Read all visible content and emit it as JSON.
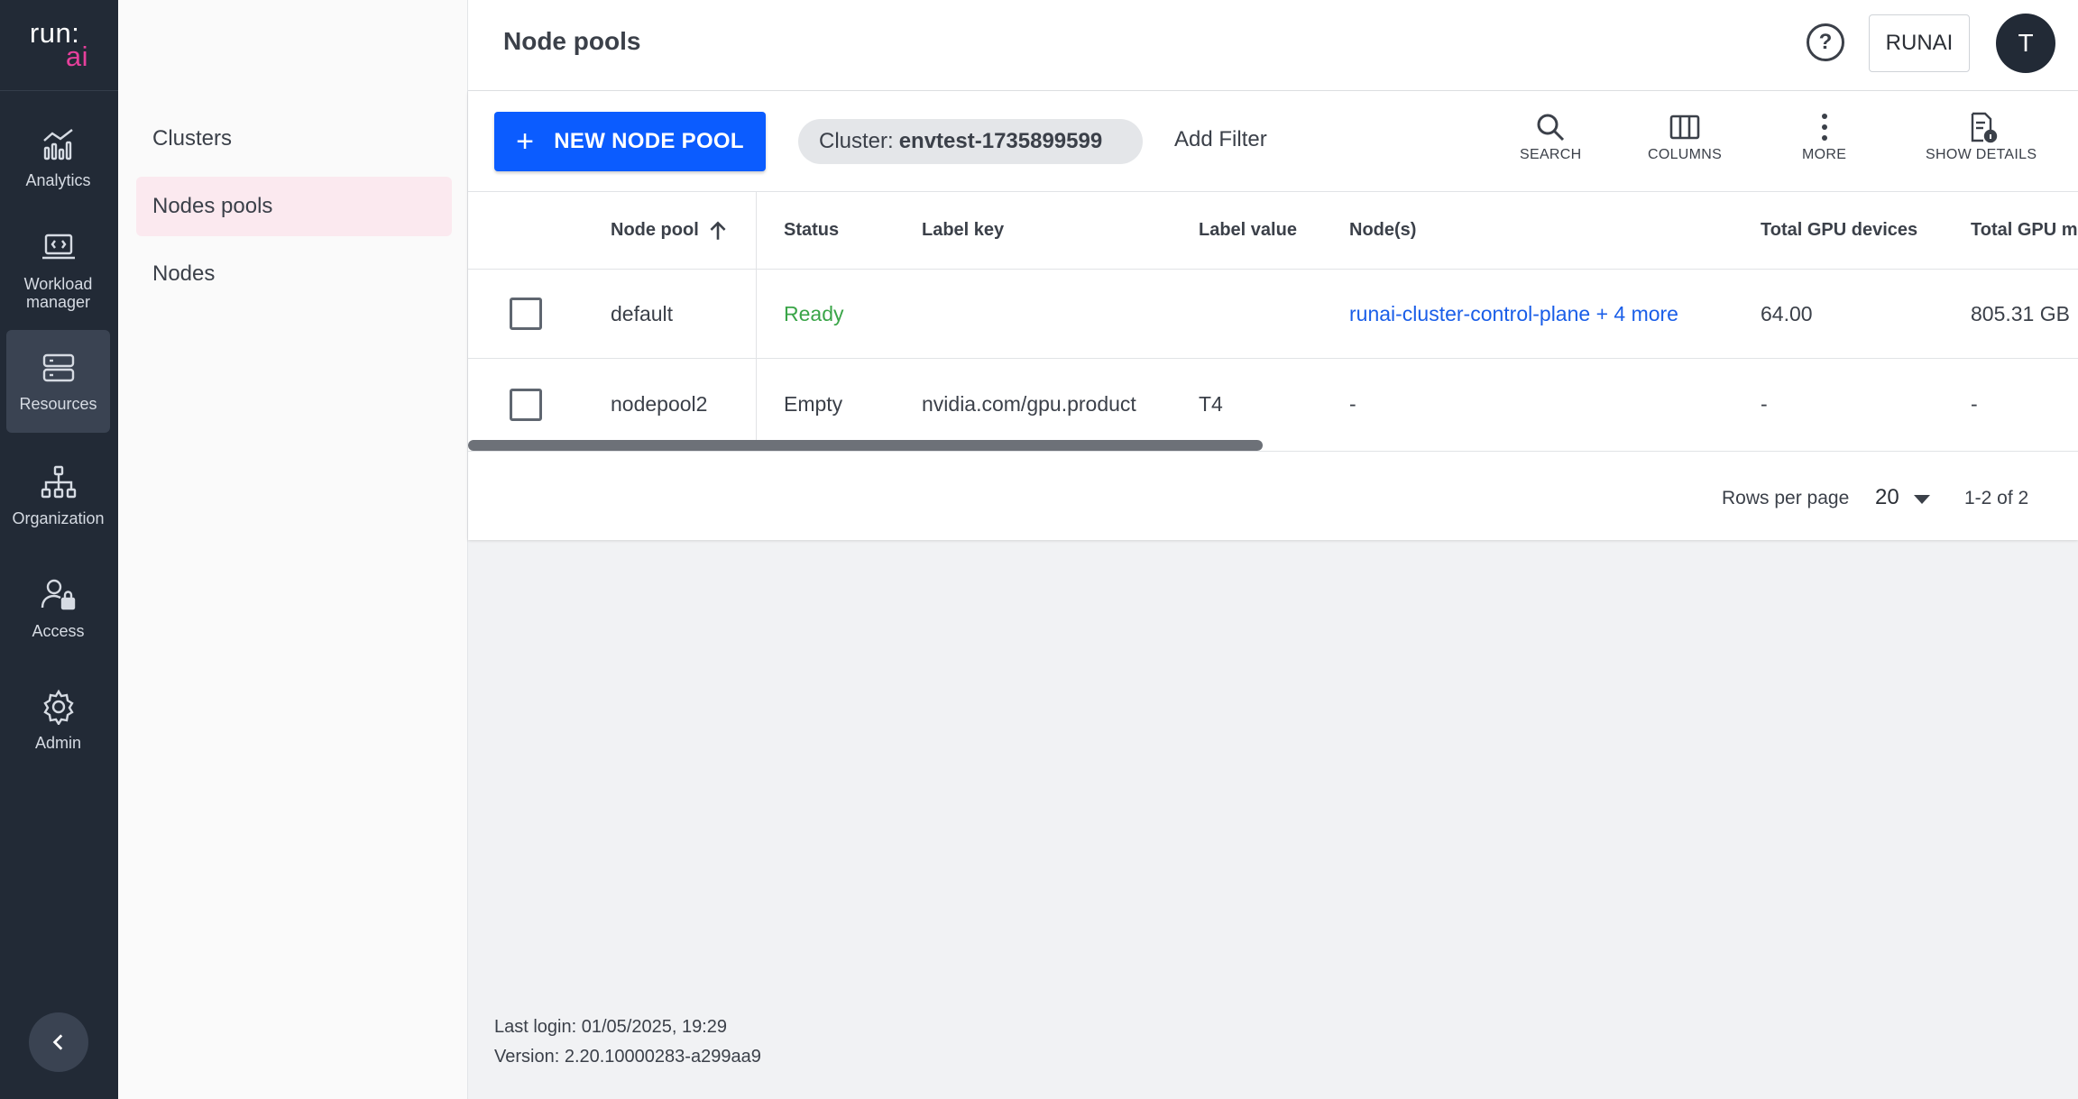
{
  "brand": {
    "logo_top": "run:",
    "logo_bottom": "ai"
  },
  "rail": {
    "items": [
      {
        "label": "Analytics",
        "icon": "analytics-icon"
      },
      {
        "label": "Workload manager",
        "icon": "laptop-code-icon"
      },
      {
        "label": "Resources",
        "icon": "server-icon",
        "active": true
      },
      {
        "label": "Organization",
        "icon": "org-chart-icon"
      },
      {
        "label": "Access",
        "icon": "user-lock-icon"
      },
      {
        "label": "Admin",
        "icon": "gear-icon"
      }
    ],
    "collapse_icon": "chevron-left-icon"
  },
  "submenu": {
    "items": [
      {
        "label": "Clusters"
      },
      {
        "label": "Nodes pools",
        "active": true
      },
      {
        "label": "Nodes"
      }
    ]
  },
  "header": {
    "title": "Node pools",
    "help": "?",
    "tenant": "RUNAI",
    "avatar": "T"
  },
  "toolbar": {
    "new_button": "NEW NODE POOL",
    "plus": "+",
    "filter_chip_key": "Cluster:",
    "filter_chip_value": "envtest-1735899599",
    "add_filter": "Add Filter",
    "search": "SEARCH",
    "columns": "COLUMNS",
    "more": "MORE",
    "show_details": "SHOW DETAILS"
  },
  "table": {
    "columns": [
      "Node pool",
      "Status",
      "Label key",
      "Label value",
      "Node(s)",
      "Total GPU devices",
      "Total GPU m"
    ],
    "sort_icon": "arrow-up-icon",
    "rows": [
      {
        "node_pool": "default",
        "status": "Ready",
        "label_key": "",
        "label_value": "",
        "nodes": "runai-cluster-control-plane + 4 more",
        "gpu_devices": "64.00",
        "gpu_memory": "805.31 GB"
      },
      {
        "node_pool": "nodepool2",
        "status": "Empty",
        "label_key": "nvidia.com/gpu.product",
        "label_value": "T4",
        "nodes": "-",
        "gpu_devices": "-",
        "gpu_memory": "-"
      }
    ]
  },
  "pagination": {
    "rows_per_page_label": "Rows per page",
    "rows_per_page": "20",
    "range": "1-2 of 2"
  },
  "footer": {
    "last_login": "Last login: 01/05/2025, 19:29",
    "version": "Version: 2.20.10000283-a299aa9"
  },
  "colors": {
    "primary": "#0b5cff",
    "rail_bg": "#222a36",
    "ready": "#3aa548",
    "link": "#1a5ee8",
    "logo_accent": "#e6409c"
  }
}
